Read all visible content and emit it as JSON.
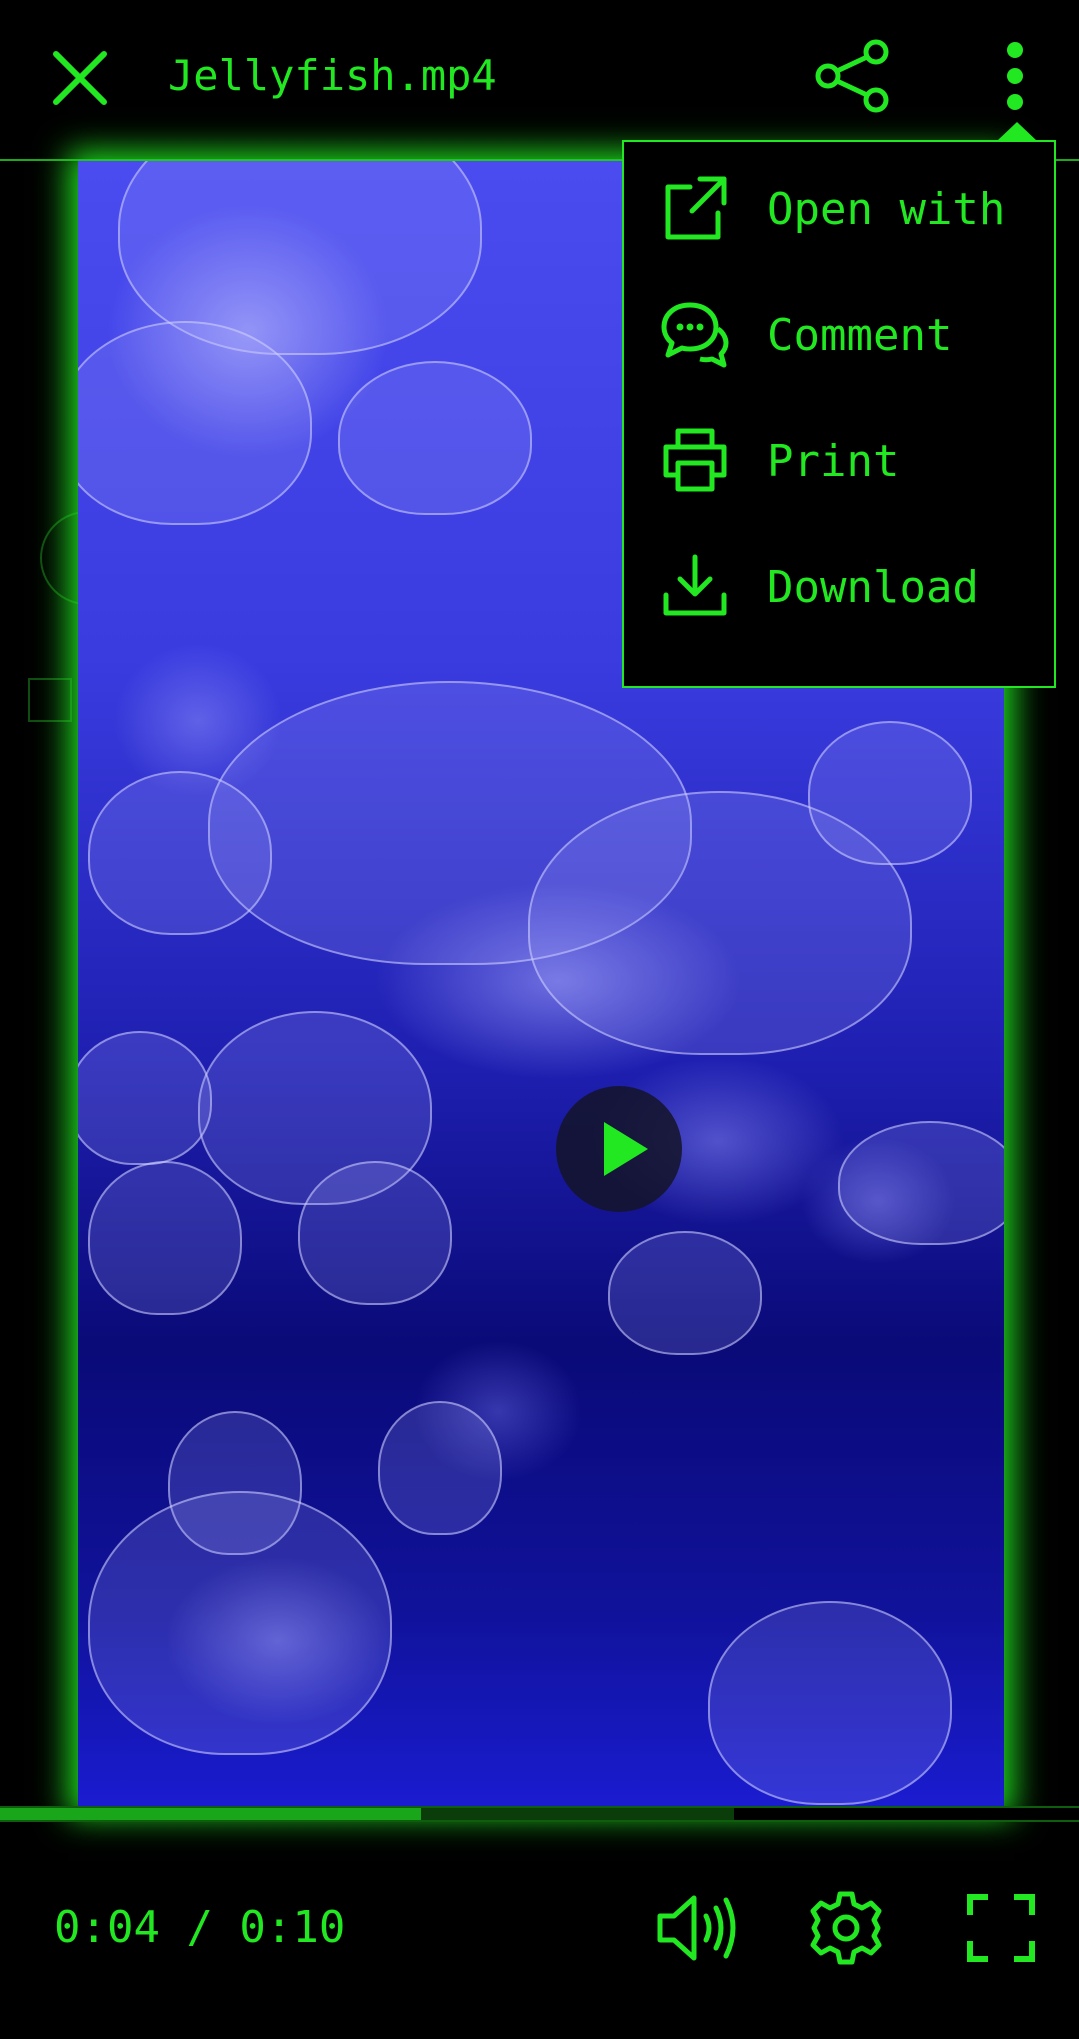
{
  "header": {
    "title": "Jellyfish.mp4",
    "close_icon": "close-icon",
    "share_icon": "share-icon",
    "more_icon": "more-vertical-icon"
  },
  "menu": {
    "items": [
      {
        "label": "Open with",
        "icon": "open-external-icon"
      },
      {
        "label": "Comment",
        "icon": "comment-icon"
      },
      {
        "label": "Print",
        "icon": "printer-icon"
      },
      {
        "label": "Download",
        "icon": "download-icon"
      }
    ]
  },
  "player": {
    "time_display": "0:04 / 0:10",
    "progress_fraction": 0.39,
    "buffered_fraction": 0.68,
    "play_icon": "play-icon",
    "volume_icon": "volume-icon",
    "settings_icon": "gear-icon",
    "fullscreen_icon": "fullscreen-icon"
  },
  "colors": {
    "accent": "#22e822",
    "background": "#000000",
    "video_blue": "#3a3ce0"
  }
}
